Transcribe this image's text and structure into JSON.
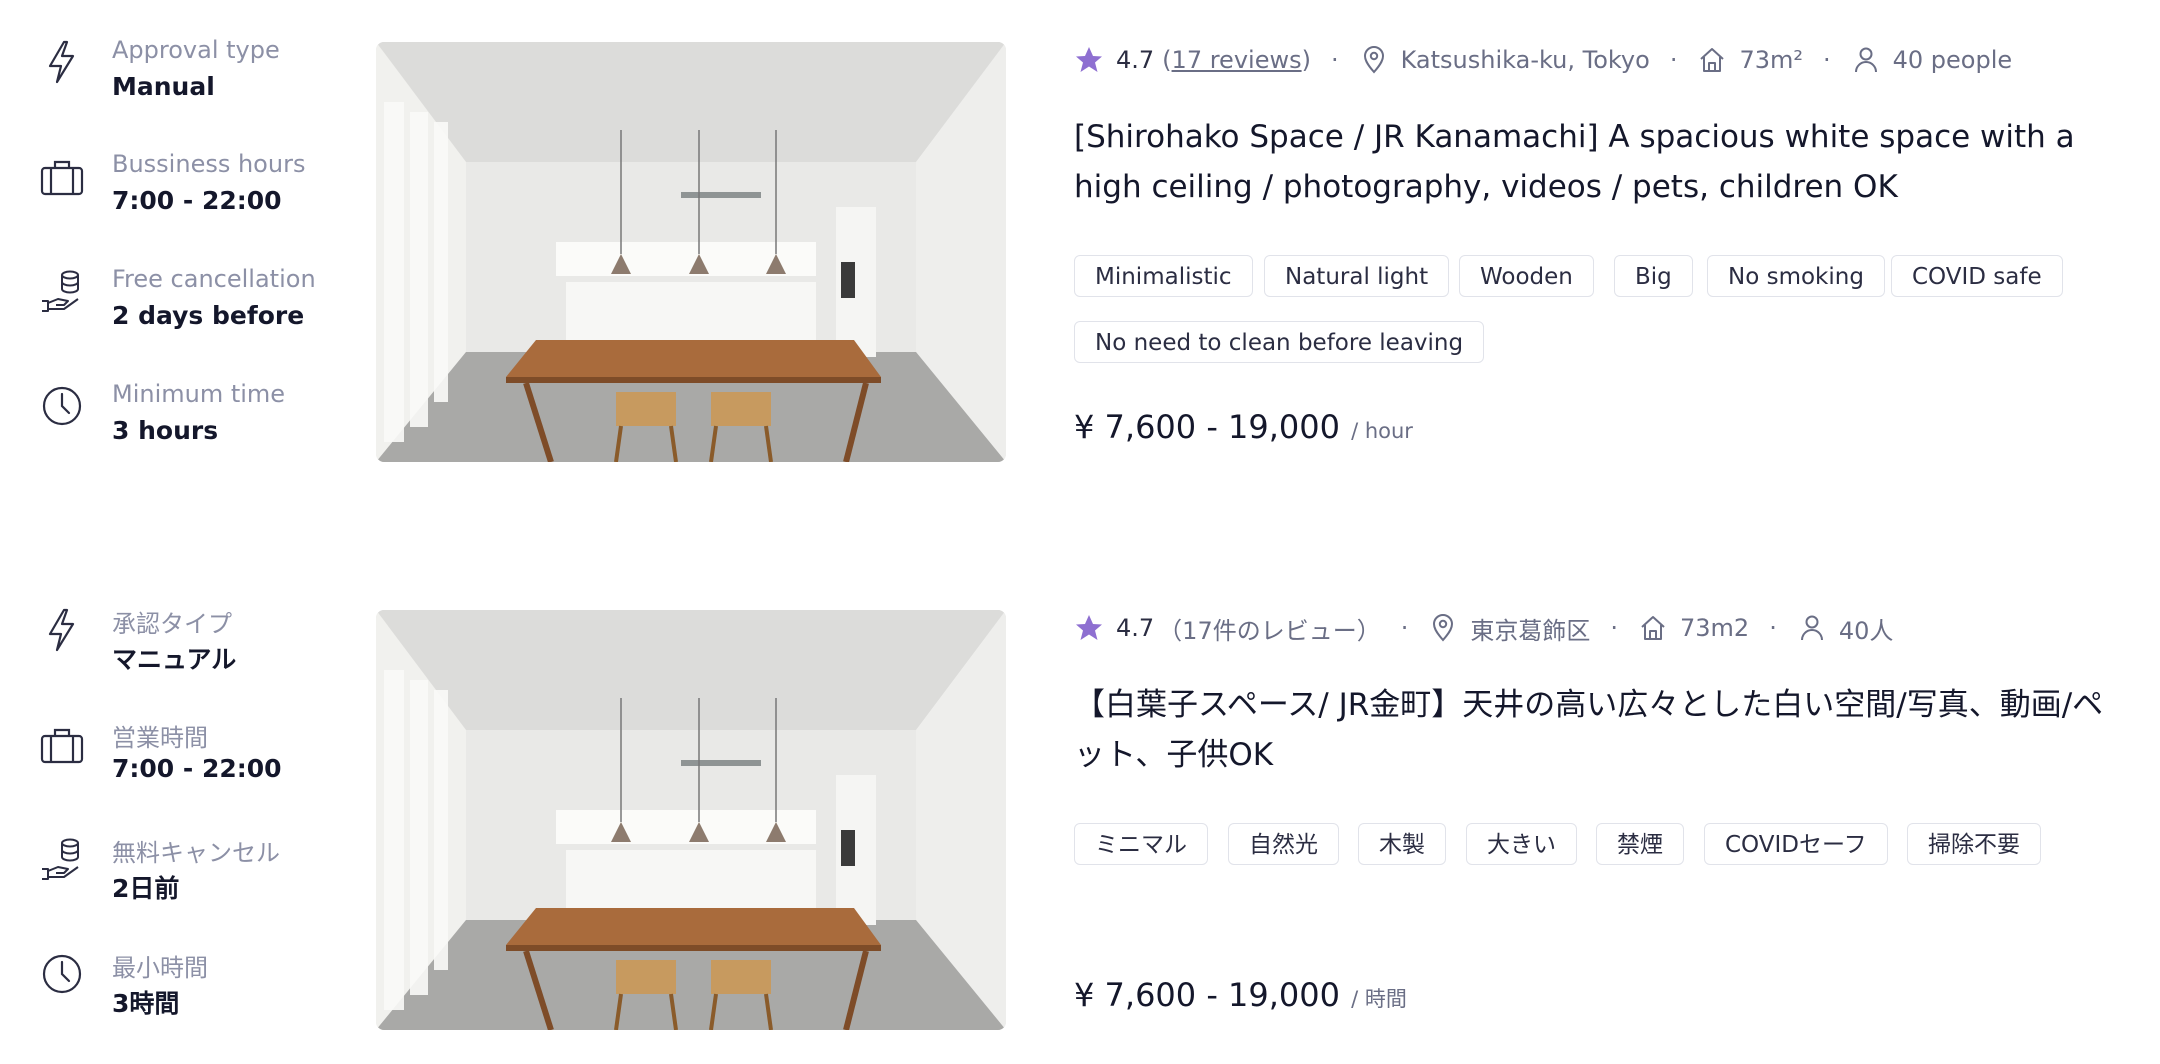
{
  "listings": [
    {
      "meta": [
        {
          "icon": "lightning-icon",
          "label": "Approval type",
          "value": "Manual"
        },
        {
          "icon": "briefcase-icon",
          "label": "Bussiness hours",
          "value": "7:00 - 22:00"
        },
        {
          "icon": "coins-hand-icon",
          "label": "Free cancellation",
          "value": "2 days before"
        },
        {
          "icon": "clock-icon",
          "label": "Minimum time",
          "value": "3 hours"
        }
      ],
      "rating": "4.7",
      "reviews": "17 reviews",
      "location": "Katsushika-ku, Tokyo",
      "area": "73m²",
      "capacity": "40 people",
      "title": "[Shirohako Space / JR Kanamachi] A spacious white space with a high ceiling / photography, videos / pets, children OK",
      "tags": [
        "Minimalistic",
        "Natural light",
        "Wooden",
        "Big",
        "No smoking",
        "COVID safe",
        "No need to clean before leaving"
      ],
      "price": "¥ 7,600 - 19,000",
      "price_unit": "/ hour"
    },
    {
      "meta": [
        {
          "icon": "lightning-icon",
          "label": "承認タイプ",
          "value": "マニュアル"
        },
        {
          "icon": "briefcase-icon",
          "label": "営業時間",
          "value": "7:00 - 22:00"
        },
        {
          "icon": "coins-hand-icon",
          "label": "無料キャンセル",
          "value": "2日前"
        },
        {
          "icon": "clock-icon",
          "label": "最小時間",
          "value": "3時間"
        }
      ],
      "rating": "4.7",
      "reviews": "（17件のレビュー）",
      "location": "東京葛飾区",
      "area": "73m2",
      "capacity": "40人",
      "title": "【白葉子スペース/ JR金町】天井の高い広々とした白い空間/写真、動画/ペット、子供OK",
      "tags": [
        "ミニマル",
        "自然光",
        "木製",
        "大きい",
        "禁煙",
        "COVIDセーフ",
        "掃除不要"
      ],
      "price": "¥ 7,600 - 19,000",
      "price_unit": "/ 時間"
    }
  ],
  "colors": {
    "accent": "#8e6fd1",
    "text": "#14172b",
    "muted": "#8c90a6",
    "border": "#e1e3ea"
  }
}
